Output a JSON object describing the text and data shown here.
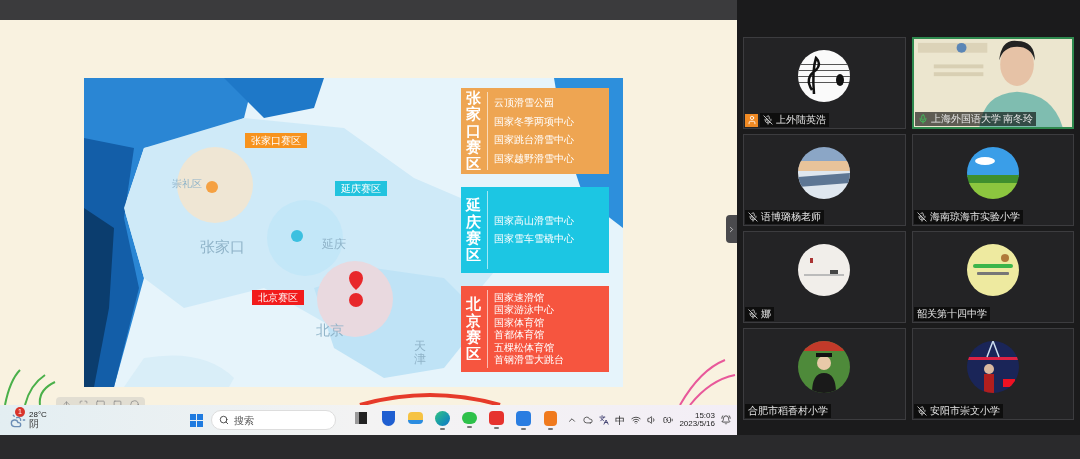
{
  "slide": {
    "map_labels": [
      {
        "text": "张家口赛区",
        "color": "#f7931e"
      },
      {
        "text": "延庆赛区",
        "color": "#22c3de"
      },
      {
        "text": "北京赛区",
        "color": "#f21c1c"
      }
    ],
    "place_names": [
      "崇礼区",
      "张家口",
      "延庆",
      "北京",
      "天津"
    ],
    "zones": [
      {
        "title": "张家口赛区",
        "color": "#eea552",
        "venues": [
          "云顶滑雪公园",
          "国家冬季两项中心",
          "国家跳台滑雪中心",
          "国家越野滑雪中心"
        ]
      },
      {
        "title": "延庆赛区",
        "color": "#1cc6e3",
        "venues": [
          "国家高山滑雪中心",
          "国家雪车雪橇中心"
        ]
      },
      {
        "title": "北京赛区",
        "color": "#f6553f",
        "venues": [
          "国家速滑馆",
          "国家游泳中心",
          "国家体育馆",
          "首都体育馆",
          "五棵松体育馆",
          "首钢滑雪大跳台"
        ]
      }
    ]
  },
  "taskbar": {
    "weather": {
      "badge": "1",
      "temperature": "28°C",
      "condition": "阴"
    },
    "search": {
      "placeholder": "搜索"
    },
    "apps": [
      {
        "kind": "taskview",
        "running": false
      },
      {
        "kind": "shield",
        "running": false
      },
      {
        "kind": "folder",
        "running": false
      },
      {
        "kind": "browser",
        "running": true
      },
      {
        "kind": "chat",
        "running": true
      },
      {
        "kind": "office",
        "running": true
      },
      {
        "kind": "meeting",
        "running": true
      },
      {
        "kind": "player",
        "running": true
      }
    ],
    "input_method": "中",
    "time": "15:03",
    "date": "2023/5/16"
  },
  "participants": [
    {
      "name": "上外陆英浩",
      "host": true,
      "muted": true,
      "speaking": false
    },
    {
      "name": "上海外国语大学 南冬玲",
      "host": false,
      "muted": false,
      "speaking": true
    },
    {
      "name": "语博璐杨老师",
      "host": false,
      "muted": true,
      "speaking": false
    },
    {
      "name": "海南琼海市实验小学",
      "host": false,
      "muted": true,
      "speaking": false
    },
    {
      "name": "娜",
      "host": false,
      "muted": true,
      "speaking": false
    },
    {
      "name": "韶关第十四中学",
      "host": false,
      "speaking": false
    },
    {
      "name": "合肥市稻香村小学",
      "host": false,
      "speaking": false
    },
    {
      "name": "安阳市崇文小学",
      "host": false,
      "muted": true,
      "speaking": false
    }
  ]
}
